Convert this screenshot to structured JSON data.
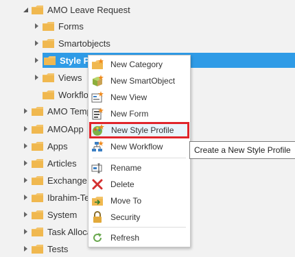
{
  "tree": {
    "root": "AMO Leave Request",
    "children": [
      "Forms",
      "Smartobjects",
      "Style Pr",
      "Views",
      "Workflo"
    ],
    "siblings": [
      "AMO Temp",
      "AMOApp",
      "Apps",
      "Articles",
      "Exchange",
      "Ibrahim-Tes",
      "System",
      "Task Alloca",
      "Tests"
    ]
  },
  "menu": {
    "items": [
      {
        "label": "New Category",
        "icon": "new-category-icon"
      },
      {
        "label": "New SmartObject",
        "icon": "new-smartobject-icon"
      },
      {
        "label": "New View",
        "icon": "new-view-icon"
      },
      {
        "label": "New Form",
        "icon": "new-form-icon"
      },
      {
        "label": "New Style Profile",
        "icon": "new-style-profile-icon"
      },
      {
        "label": "New Workflow",
        "icon": "new-workflow-icon"
      },
      {
        "label": "Rename",
        "icon": "rename-icon"
      },
      {
        "label": "Delete",
        "icon": "delete-icon"
      },
      {
        "label": "Move To",
        "icon": "move-to-icon"
      },
      {
        "label": "Security",
        "icon": "lock-icon"
      },
      {
        "label": "Refresh",
        "icon": "refresh-icon"
      }
    ]
  },
  "tooltip": "Create a New Style Profile",
  "colors": {
    "selection": "#2f9be6",
    "highlight": "#e0242b",
    "folder": "#f3c46b"
  }
}
